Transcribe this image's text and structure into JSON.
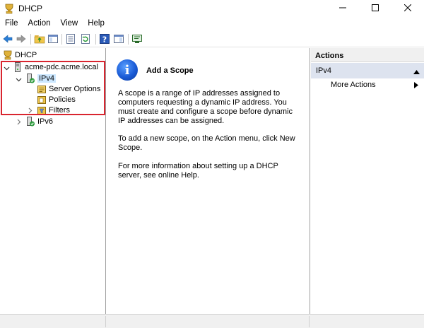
{
  "window": {
    "title": "DHCP",
    "app_icon": "dhcp-icon",
    "controls": [
      "minimize-icon",
      "maximize-icon",
      "close-icon"
    ]
  },
  "menu": [
    "File",
    "Action",
    "View",
    "Help"
  ],
  "toolbar": {
    "buttons": [
      "back-arrow-icon",
      "forward-arrow-icon",
      "up-folder-icon",
      "show-hide-console-tree-icon",
      "properties-icon",
      "refresh-icon",
      "help-icon",
      "show-action-pane-icon",
      "console-icon"
    ]
  },
  "tree": {
    "root": "DHCP",
    "server": "acme-pdc.acme.local",
    "ipv4": "IPv4",
    "server_options": "Server Options",
    "policies": "Policies",
    "filters": "Filters",
    "ipv6": "IPv6"
  },
  "center": {
    "title": "Add a Scope",
    "para1": "A scope is a range of IP addresses assigned to computers requesting a dynamic IP address. You must create and configure a scope before dynamic IP addresses can be assigned.",
    "para2": "To add a new scope, on the Action menu, click New Scope.",
    "para3": "For more information about setting up a DHCP server, see online Help."
  },
  "actions": {
    "header": "Actions",
    "section": "IPv4",
    "item": "More Actions"
  },
  "colors": {
    "selection": "#cde8ff",
    "highlight_border": "#d9252f",
    "actions_section_bg": "#dde3ef"
  }
}
